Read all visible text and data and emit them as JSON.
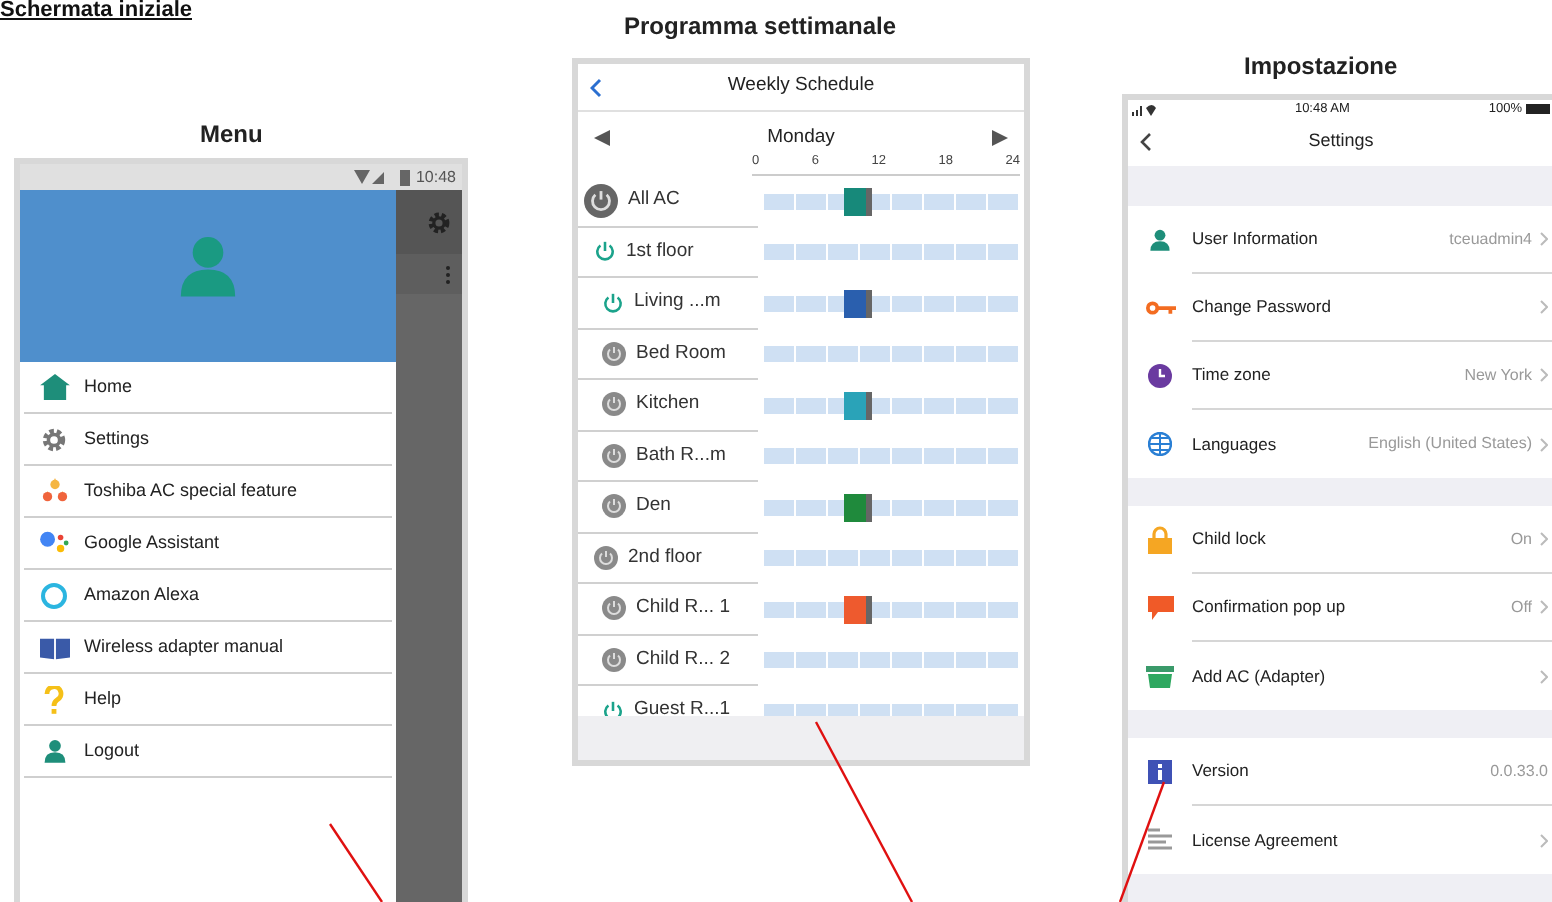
{
  "page_heading": "Schermata iniziale",
  "menu": {
    "title": "Menu",
    "status_time": "10:48",
    "items": [
      {
        "label": "Home"
      },
      {
        "label": "Settings"
      },
      {
        "label": "Toshiba AC special feature"
      },
      {
        "label": "Google Assistant"
      },
      {
        "label": "Amazon Alexa"
      },
      {
        "label": "Wireless adapter manual"
      },
      {
        "label": "Help"
      },
      {
        "label": "Logout"
      }
    ]
  },
  "schedule": {
    "title": "Programma settimanale",
    "screen_title": "Weekly Schedule",
    "day": "Monday",
    "ticks": [
      "0",
      "6",
      "12",
      "18",
      "24"
    ],
    "rows": [
      {
        "label": "All AC",
        "on": false,
        "color": "#17897a"
      },
      {
        "label": "1st floor",
        "on": true,
        "children": [
          {
            "label": "Living ...m",
            "on": true,
            "color": "#2a5fae"
          },
          {
            "label": "Bed Room",
            "on": false
          },
          {
            "label": "Kitchen",
            "on": false,
            "color": "#2aa3b8"
          },
          {
            "label": "Bath R...m",
            "on": false
          },
          {
            "label": "Den",
            "on": false,
            "color": "#1f8a3c"
          }
        ]
      },
      {
        "label": "2nd floor",
        "on": false,
        "children": [
          {
            "label": "Child R... 1",
            "on": false,
            "color": "#ee5a2e"
          },
          {
            "label": "Child R... 2",
            "on": false
          },
          {
            "label": "Guest R...1",
            "on": true
          }
        ]
      }
    ]
  },
  "settings": {
    "title": "Impostazione",
    "status_time": "10:48 AM",
    "battery": "100%",
    "screen_title": "Settings",
    "groups": [
      {
        "items": [
          {
            "label": "User Information",
            "value": "tceuadmin4",
            "chevron": true
          },
          {
            "label": "Change Password",
            "chevron": true
          },
          {
            "label": "Time zone",
            "value": "New York",
            "chevron": true
          },
          {
            "label": "Languages",
            "value": "English (United States)",
            "chevron": true
          }
        ]
      },
      {
        "items": [
          {
            "label": "Child lock",
            "value": "On",
            "chevron": true
          },
          {
            "label": "Confirmation pop up",
            "value": "Off",
            "chevron": true
          },
          {
            "label": "Add AC (Adapter)",
            "chevron": true
          }
        ]
      },
      {
        "items": [
          {
            "label": "Version",
            "value": "0.0.33.0",
            "chevron": false
          },
          {
            "label": "License Agreement",
            "chevron": true
          }
        ]
      }
    ]
  }
}
